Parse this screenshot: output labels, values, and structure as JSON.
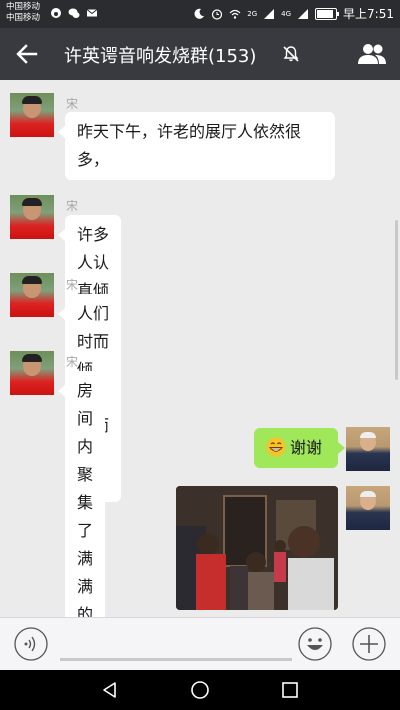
{
  "status_bar": {
    "carrier_1": "中国移动",
    "carrier_2": "中国移动",
    "time_label": "早上7:51",
    "network_label": "4G",
    "network_label_2": "2G"
  },
  "header": {
    "title": "许英谔音响发烧群(153)",
    "muted": true,
    "background_color": "#393a3f"
  },
  "messages": [
    {
      "sender": "宋云研",
      "side": "left",
      "lines": [
        "昨天下午，许老的展厅人依然很",
        "多，"
      ]
    },
    {
      "sender": "宋云研",
      "side": "left",
      "lines": [
        "许多人认真倾听！"
      ]
    },
    {
      "sender": "宋云研",
      "side": "left",
      "lines": [
        "人们时而倾听，时而询问！"
      ]
    },
    {
      "sender": "宋云研",
      "side": "left",
      "lines": [
        "房间内聚集了满满的人气"
      ]
    },
    {
      "sender": "",
      "side": "right",
      "emoji": "grin-emoji-icon",
      "text": "谢谢"
    },
    {
      "sender": "",
      "side": "right",
      "type": "photo"
    }
  ],
  "colors": {
    "chat_background": "#ebebeb",
    "self_bubble": "#a0e75a",
    "other_bubble": "#ffffff"
  },
  "input_bar": {
    "placeholder": ""
  }
}
